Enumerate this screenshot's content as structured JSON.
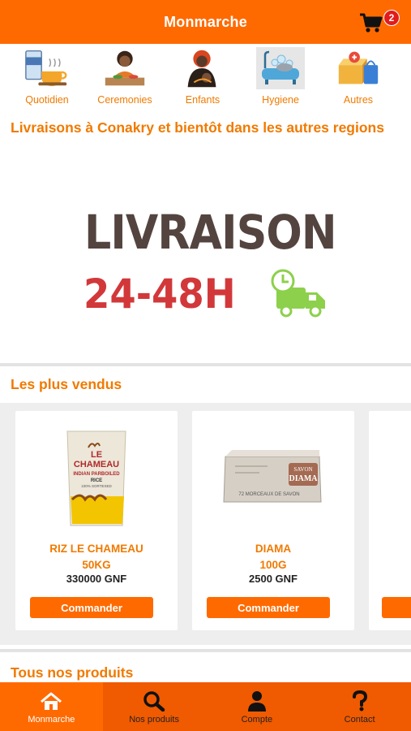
{
  "header": {
    "title": "Monmarche",
    "cart_count": "2"
  },
  "categories": [
    {
      "label": "Quotidien",
      "icon": "breakfast-icon"
    },
    {
      "label": "Ceremonies",
      "icon": "ceremony-meal-icon"
    },
    {
      "label": "Enfants",
      "icon": "mother-child-icon"
    },
    {
      "label": "Hygiene",
      "icon": "bathtub-icon"
    },
    {
      "label": "Autres",
      "icon": "boxes-icon"
    }
  ],
  "banner": {
    "title": "Livraisons à Conakry et bientôt dans les autres regions",
    "word": "LIVRAISON",
    "time": "24-48H"
  },
  "best_sellers": {
    "title": "Les plus vendus",
    "products": [
      {
        "name": "RIZ LE CHAMEAU",
        "size": "50KG",
        "price": "330000 GNF",
        "button": "Commander",
        "bag_text": [
          "LE",
          "CHAMEAU",
          "INDIAN PARBOILED",
          "RICE",
          "100% SORTEXED"
        ]
      },
      {
        "name": "DIAMA",
        "size": "100G",
        "price": "2500 GNF",
        "button": "Commander",
        "box_text": [
          "SAVON",
          "DIAMA",
          "72 MORCEAUX DE SAVON"
        ]
      }
    ]
  },
  "all_products": {
    "title": "Tous nos produits"
  },
  "nav": [
    {
      "label": "Monmarche",
      "icon": "home-icon"
    },
    {
      "label": "Nos produits",
      "icon": "search-icon"
    },
    {
      "label": "Compte",
      "icon": "user-icon"
    },
    {
      "label": "Contact",
      "icon": "question-icon"
    }
  ],
  "colors": {
    "accent": "#FF6A00",
    "title_orange": "#F07A00",
    "badge": "#e31b1b"
  }
}
